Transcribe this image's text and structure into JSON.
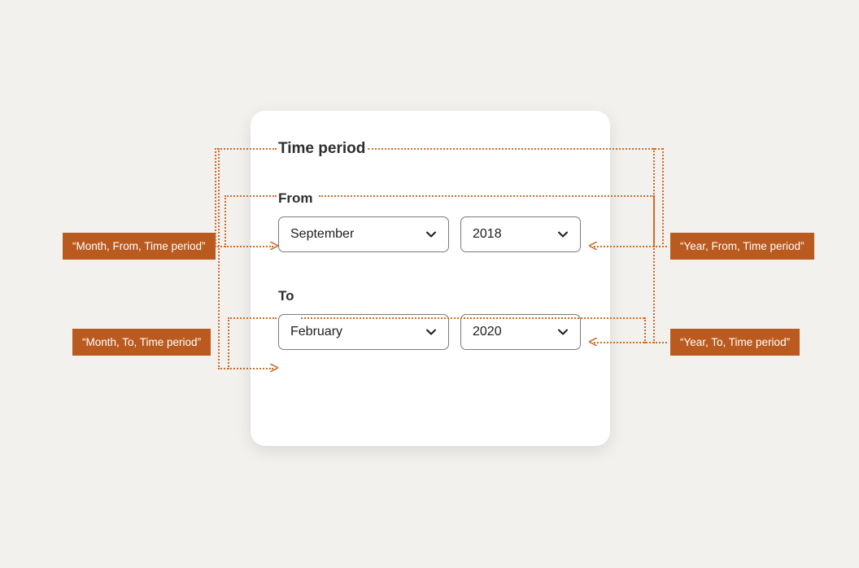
{
  "card": {
    "title": "Time period",
    "from": {
      "label": "From",
      "month": "September",
      "year": "2018"
    },
    "to": {
      "label": "To",
      "month": "February",
      "year": "2020"
    }
  },
  "annotations": {
    "monthFrom": "“Month, From, Time period”",
    "yearFrom": "“Year, From, Time period”",
    "monthTo": "“Month, To, Time period”",
    "yearTo": "“Year, To, Time period”"
  }
}
